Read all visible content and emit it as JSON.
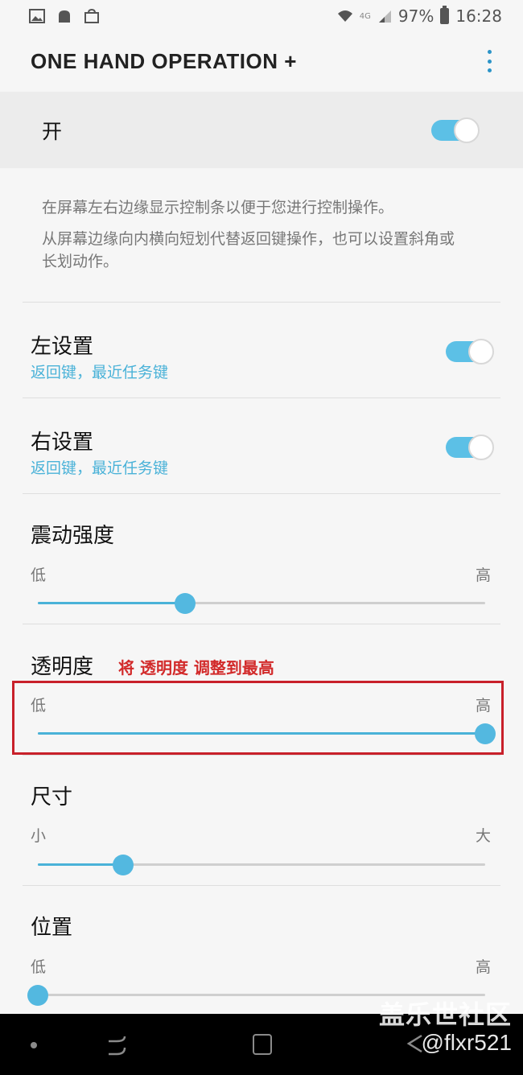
{
  "status_bar": {
    "network": "4G",
    "battery": "97%",
    "time": "16:28"
  },
  "app_bar": {
    "title": "ONE HAND OPERATION +"
  },
  "master_switch": {
    "label": "开",
    "on": true
  },
  "description": {
    "line1": "在屏幕左右边缘显示控制条以便于您进行控制操作。",
    "line2": "从屏幕边缘向内横向短划代替返回键操作，也可以设置斜角或长划动作。"
  },
  "left_settings": {
    "title": "左设置",
    "subtitle": "返回键，最近任务键",
    "on": true
  },
  "right_settings": {
    "title": "右设置",
    "subtitle": "返回键，最近任务键",
    "on": true
  },
  "vibration": {
    "title": "震动强度",
    "min_label": "低",
    "max_label": "高",
    "value": 0.33
  },
  "transparency": {
    "title": "透明度",
    "annotation": "将 透明度 调整到最高",
    "min_label": "低",
    "max_label": "高",
    "value": 1.0
  },
  "size": {
    "title": "尺寸",
    "min_label": "小",
    "max_label": "大",
    "value": 0.19
  },
  "position": {
    "title": "位置",
    "min_label": "低",
    "max_label": "高",
    "value": 0.0
  },
  "watermark": {
    "line1": "盖乐世社区",
    "line2": "@flxr521"
  },
  "colors": {
    "accent": "#4ab2d8",
    "annotation": "#d22a2a"
  }
}
